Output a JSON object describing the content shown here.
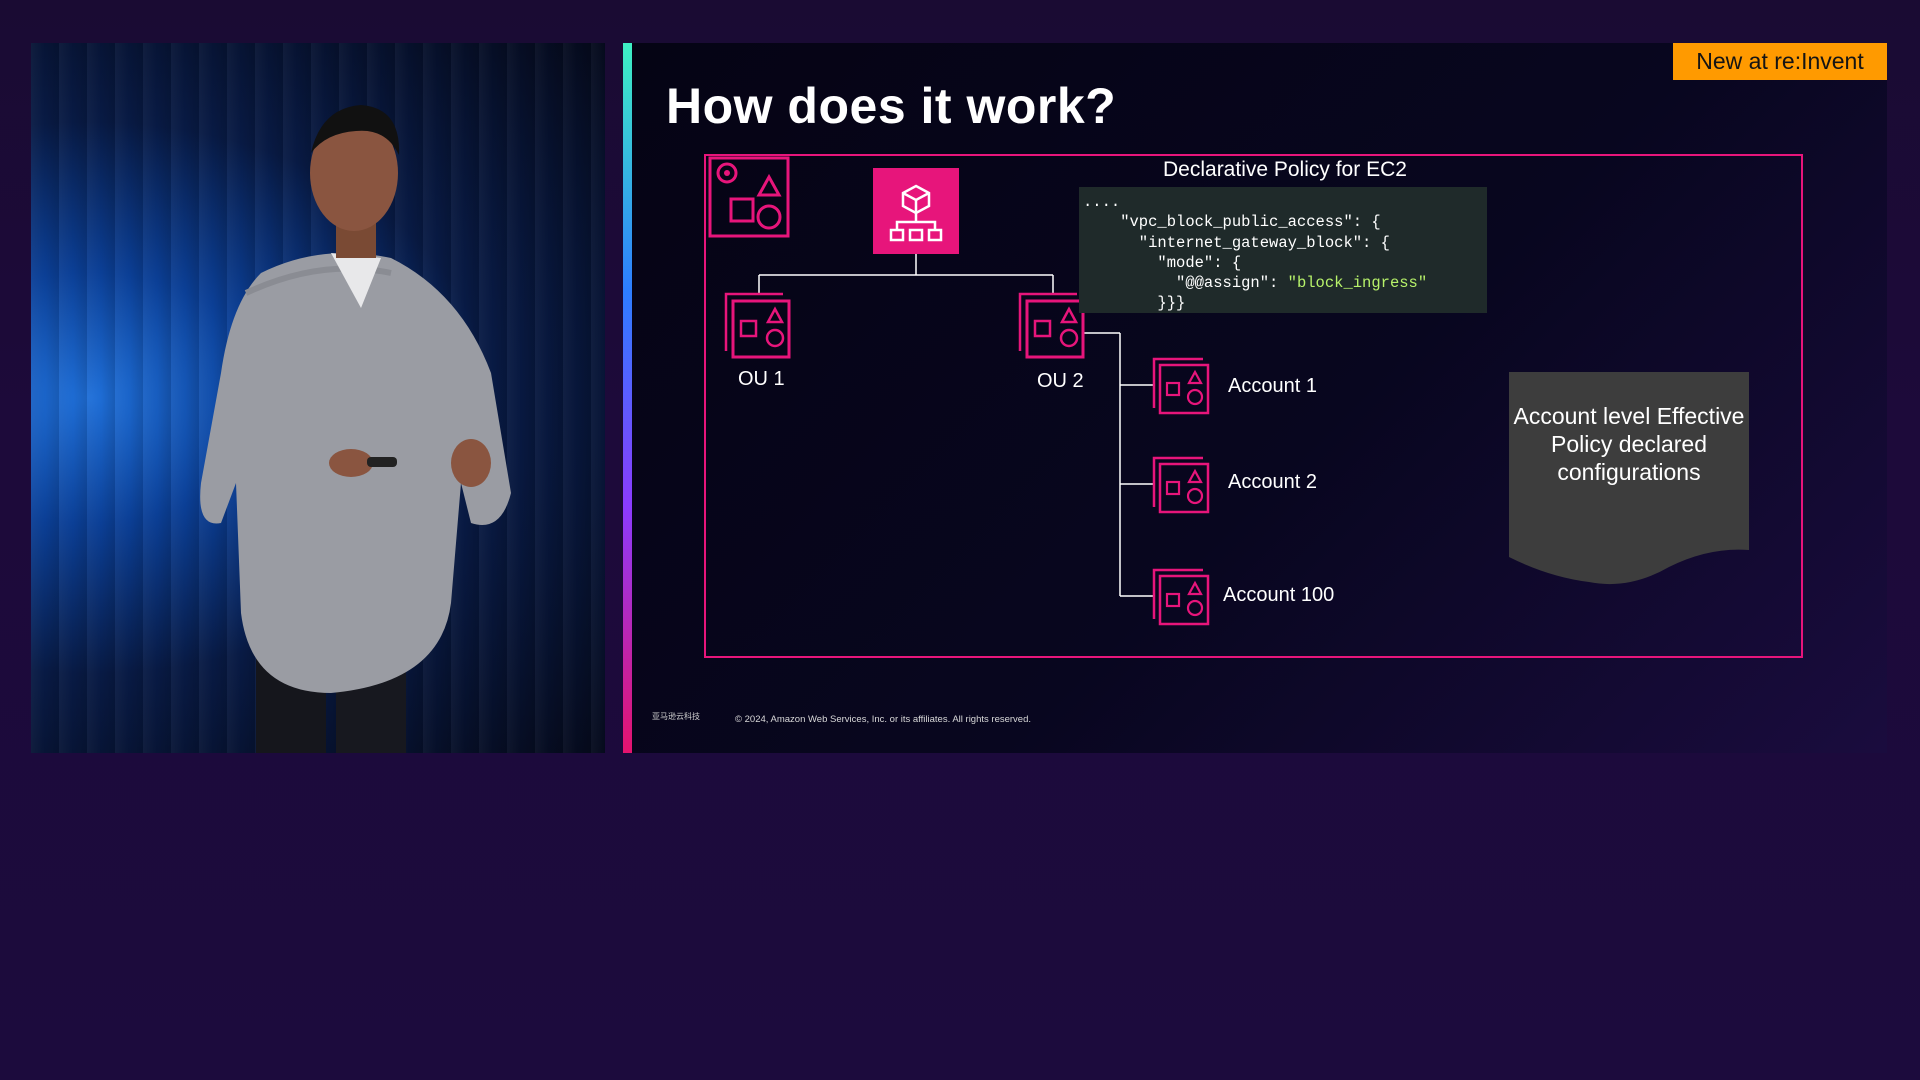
{
  "video": {
    "description_hidden": true
  },
  "slide": {
    "title": "How does it work?",
    "badge": "New at re:Invent",
    "policy_title": "Declarative Policy for EC2",
    "code_lines": [
      {
        "text": "....",
        "str": ""
      },
      {
        "text": "    \"vpc_block_public_access\": {",
        "str": ""
      },
      {
        "text": "      \"internet_gateway_block\": {",
        "str": ""
      },
      {
        "text": "        \"mode\": {",
        "str": ""
      },
      {
        "text": "          \"@@assign\": ",
        "str": "\"block_ingress\""
      },
      {
        "text": "        }}}",
        "str": ""
      }
    ],
    "ou1_label": "OU 1",
    "ou2_label": "OU 2",
    "accounts": [
      "Account 1",
      "Account 2",
      "Account 100"
    ],
    "effective_policy": "Account level Effective Policy declared configurations",
    "copyright": "© 2024, Amazon Web Services, Inc. or its affiliates. All rights reserved.",
    "logo_text": "亚马逊云科技"
  },
  "colors": {
    "accent_pink": "#e7157b",
    "badge_orange": "#ff9a00",
    "code_bg": "#1f2a2a",
    "code_string": "#b7f26a",
    "note_gray": "#3d3d3d"
  },
  "icons": [
    "management-account-icon",
    "organization-root-icon",
    "ou-icon",
    "account-icon"
  ]
}
